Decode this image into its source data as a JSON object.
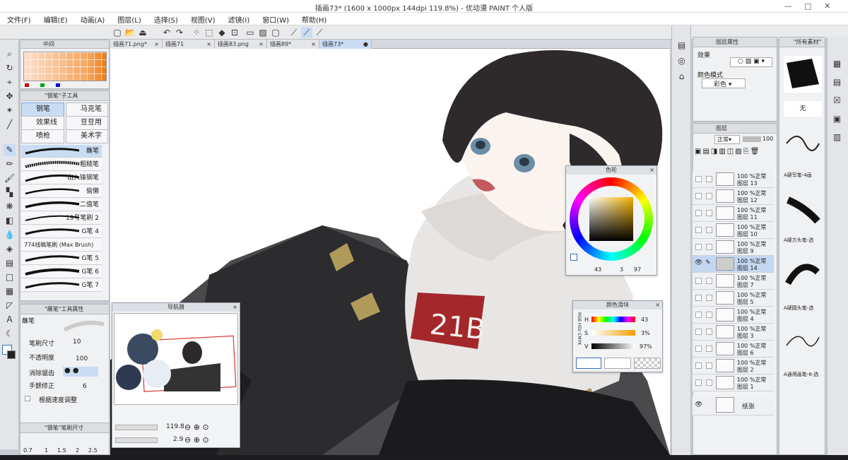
{
  "window": {
    "title": "插画73* (1600 x 1000px 144dpi 119.8%)  - 优动漫 PAINT 个人版",
    "minimize": "—",
    "maximize": "□",
    "close": "✕"
  },
  "menu": [
    "文件(F)",
    "编辑(E)",
    "动画(A)",
    "图层(L)",
    "选择(S)",
    "视图(V)",
    "滤镜(I)",
    "窗口(W)",
    "帮助(H)"
  ],
  "doc_tabs": [
    {
      "label": "插画71.png*",
      "close": "×"
    },
    {
      "label": "插画71",
      "close": "×"
    },
    {
      "label": "插画83.png",
      "close": "×"
    },
    {
      "label": "插画89*",
      "close": "×"
    },
    {
      "label": "插画73*",
      "close": "●"
    }
  ],
  "color_set_panel": {
    "tab_label": "中间"
  },
  "sub_tool_panel": {
    "title": "\"钢笔\"子工具",
    "tabs": [
      "钢笔",
      "马克笔",
      "效果线专用",
      "豆豆用黑",
      "喷枪",
      "美术字"
    ],
    "brushes": [
      "蘸笔",
      "粗糙笔",
      "出入锋钢笔",
      "偷懒",
      "二值笔",
      "19号笔刷 2",
      "G笔 4",
      "774线稿笔刷 (Max Brush)",
      "G笔 5",
      "G笔 6",
      "G笔 7"
    ]
  },
  "tool_property": {
    "title": "\"蘸笔\"工具属性",
    "brush_name": "蘸笔",
    "rows": [
      {
        "label": "笔刷尺寸",
        "value": "10"
      },
      {
        "label": "不透明度",
        "value": "100"
      },
      {
        "label": "消除锯齿",
        "value": ""
      },
      {
        "label": "手颤修正",
        "value": "6"
      },
      {
        "label": "根据速度调整",
        "value": ""
      }
    ]
  },
  "brush_size_panel": {
    "title": "\"钢笔\"笔刷尺寸",
    "sizes": [
      "0.7",
      "1",
      "1.5",
      "2",
      "2.5"
    ]
  },
  "navigator": {
    "title": "导航器",
    "zoom": "119.8",
    "rotation": "2.9"
  },
  "color_wheel": {
    "title": "色轮",
    "h": "43",
    "s": "3",
    "v": "97"
  },
  "color_slider": {
    "title": "颜色滑块",
    "labels": [
      "H",
      "S",
      "V"
    ],
    "values": [
      "43",
      "3%",
      "97%"
    ],
    "side_tabs": [
      "RGB",
      "HSV",
      "CMYK"
    ]
  },
  "layer_property": {
    "title": "图层属性",
    "effect_label": "效果",
    "color_mode_label": "颜色模式",
    "color_mode_value": "彩色"
  },
  "layer_panel": {
    "title": "图层",
    "blend_mode": "正常",
    "opacity": "100",
    "layers": [
      {
        "opacity": "100 %正常",
        "name": "图层 13"
      },
      {
        "opacity": "100 %正常",
        "name": "图层 12"
      },
      {
        "opacity": "100 %正常",
        "name": "图层 11"
      },
      {
        "opacity": "100 %正常",
        "name": "图层 10"
      },
      {
        "opacity": "100 %正常",
        "name": "图层 9"
      },
      {
        "opacity": "100 %正常",
        "name": "图层 14"
      },
      {
        "opacity": "100 %正常",
        "name": "图层 7"
      },
      {
        "opacity": "100 %正常",
        "name": "图层 5"
      },
      {
        "opacity": "100 %正常",
        "name": "图层 4"
      },
      {
        "opacity": "100 %正常",
        "name": "图层 3"
      },
      {
        "opacity": "100 %正常",
        "name": "图层 6"
      },
      {
        "opacity": "100 %正常",
        "name": "图层 2"
      },
      {
        "opacity": "100 %正常",
        "name": "图层 1"
      }
    ],
    "paper_label": "纸张"
  },
  "material_panel": {
    "title": "\"所有素材\"",
    "none_label": "无",
    "items": [
      "A硬写笔-4画",
      "A硬方头笔-选",
      "A硬圆头笔-选",
      "A通用画笔-6-选"
    ]
  },
  "canvas_text": "21B",
  "colors": {
    "accent": "#c9dcf3",
    "panel_bg": "#f0f1f3",
    "canvas_bg": "#ffffff",
    "hoodie_patch": "#a3282b",
    "hair": "#2e2a2c"
  }
}
